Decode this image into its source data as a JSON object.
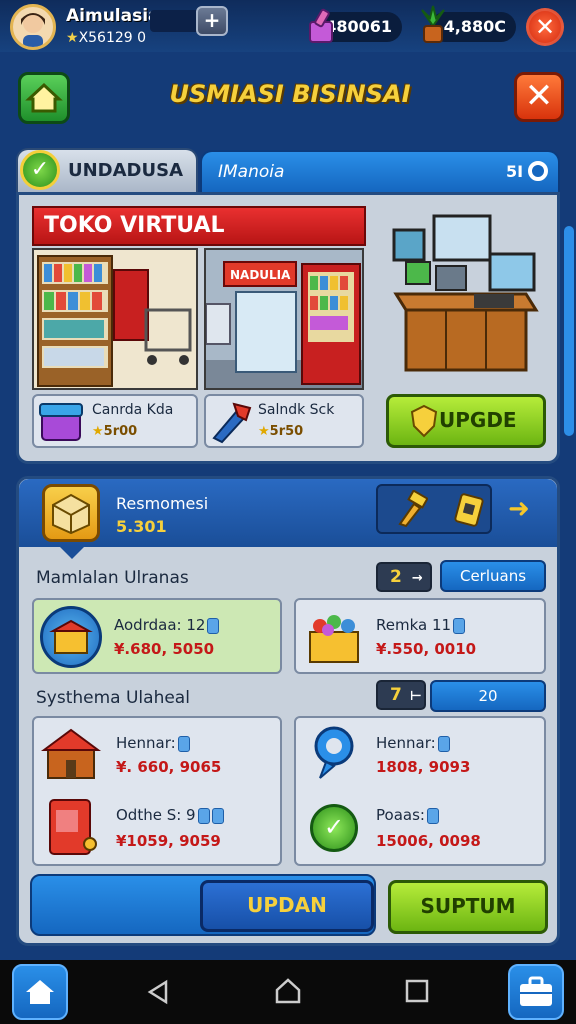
{
  "player": {
    "name": "Aimulasia",
    "coins": "X56129 0"
  },
  "resources": {
    "gems": "480061",
    "plants": "4,880C"
  },
  "header": {
    "title": "USMIASI BISINSAI"
  },
  "tabs": [
    {
      "label": "UNDADUSA"
    },
    {
      "label": "IManoia",
      "count": "5I"
    }
  ],
  "shop": {
    "banner": "TOKO VIRTUAL",
    "items": [
      {
        "name": "Canrda Kda",
        "value": "5r00"
      },
      {
        "name": "Salndk Sck",
        "value": "5r50"
      }
    ],
    "upgrade_label": "UPGDE"
  },
  "recommend": {
    "title": "Resmomesi",
    "value": "5.301"
  },
  "section1": {
    "title": "Mamlalan Ulranas",
    "qty": "2",
    "button": "Cerluans",
    "items": [
      {
        "name": "Aodrdaa: 12",
        "price": "¥.680, 5050"
      },
      {
        "name": "Remka 11",
        "price": "¥.550, 0010"
      }
    ]
  },
  "section2": {
    "title": "Systhema Ulaheal",
    "qty": "7",
    "value": "20",
    "items": [
      {
        "name": "Hennar:",
        "price": "¥. 660, 9065"
      },
      {
        "name": "Hennar:",
        "price": "1808, 9093"
      },
      {
        "name": "Odthe S: 9",
        "price": "¥1059, 9059"
      },
      {
        "name": "Poaas:",
        "price": "15006, 0098"
      }
    ]
  },
  "actions": {
    "update": "UPDAN",
    "support": "SUPTUM"
  }
}
